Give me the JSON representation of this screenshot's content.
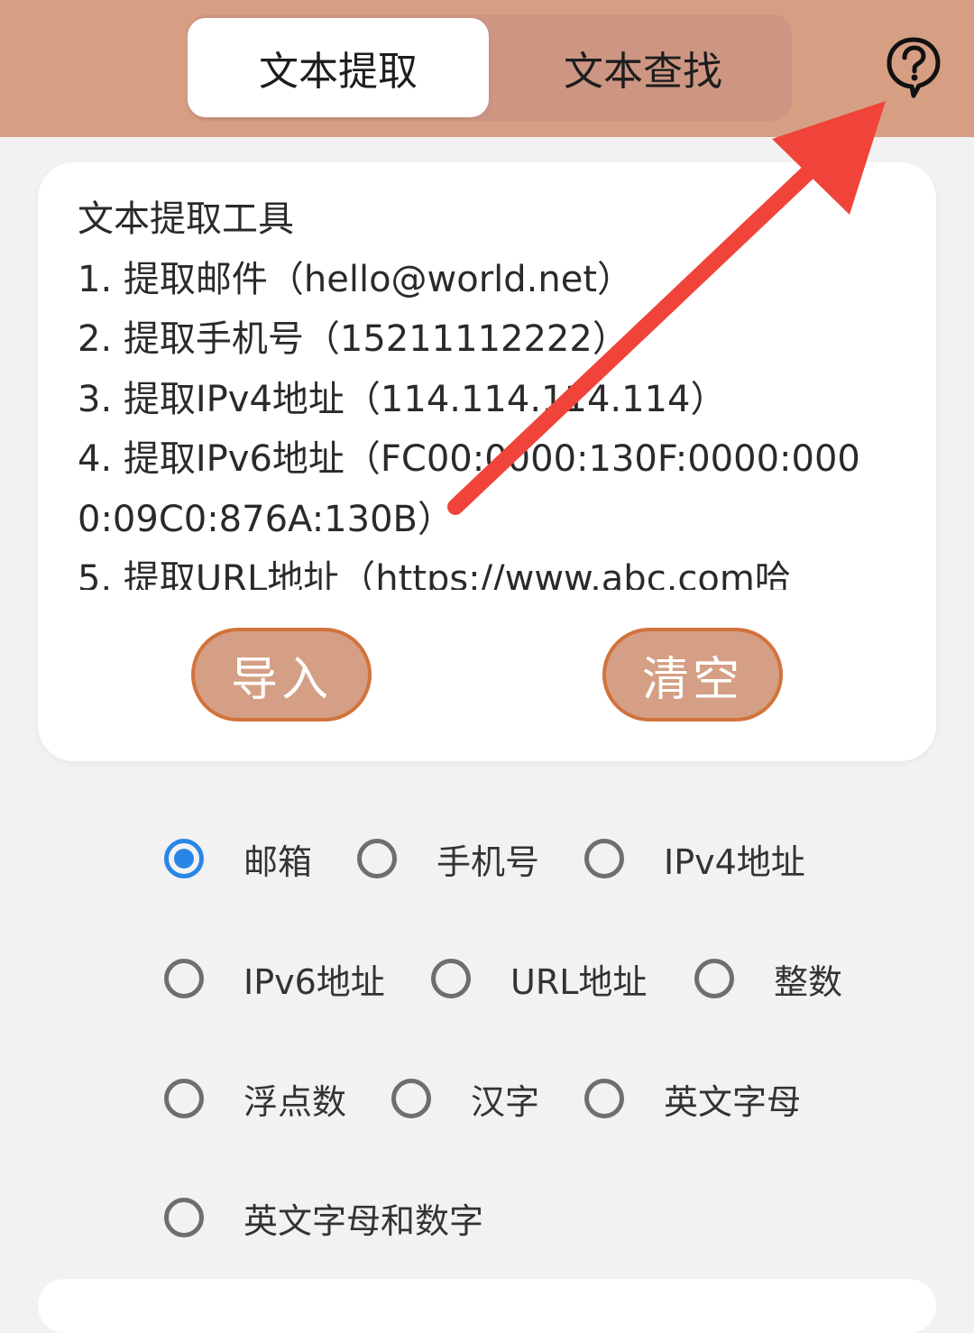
{
  "tabs": [
    {
      "label": "文本提取",
      "active": true
    },
    {
      "label": "文本查找",
      "active": false
    }
  ],
  "colors": {
    "header": "#d69f83",
    "accent_orange": "#d2733c",
    "radio_checked": "#2a86e6",
    "annotation_arrow": "#f0443a"
  },
  "help_icon": "help-circle-icon",
  "card": {
    "text": "文本提取工具\n1. 提取邮件（hello@world.net）\n2. 提取手机号（15211112222）\n3. 提取IPv4地址（114.114.114.114）\n4. 提取IPv6地址（FC00:0000:130F:0000:0000:09C0:876A:130B）\n5. 提取URL地址（https://www.abc.com哈"
  },
  "buttons": {
    "import": "导入",
    "clear": "清空"
  },
  "options": [
    {
      "label": "邮箱",
      "checked": true
    },
    {
      "label": "手机号",
      "checked": false
    },
    {
      "label": "IPv4地址",
      "checked": false
    },
    {
      "label": "IPv6地址",
      "checked": false
    },
    {
      "label": "URL地址",
      "checked": false
    },
    {
      "label": "整数",
      "checked": false
    },
    {
      "label": "浮点数",
      "checked": false
    },
    {
      "label": "汉字",
      "checked": false
    },
    {
      "label": "英文字母",
      "checked": false
    },
    {
      "label": "英文字母和数字",
      "checked": false
    }
  ]
}
